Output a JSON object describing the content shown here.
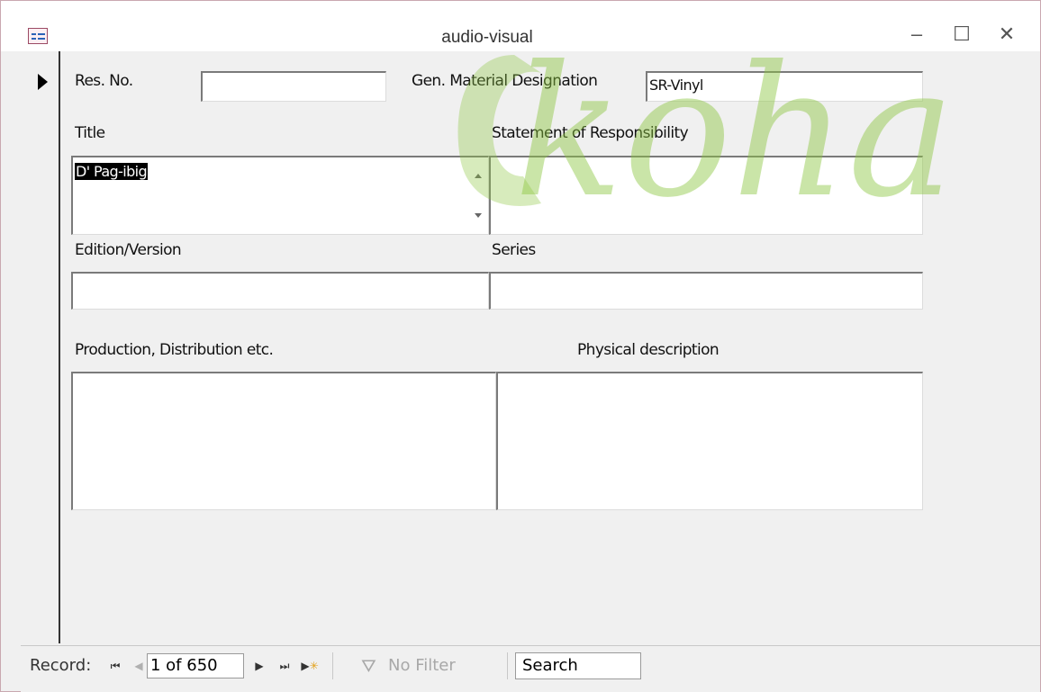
{
  "window": {
    "title": "audio-visual",
    "controls": {
      "minimize": "–",
      "maximize": "☐",
      "close": "✕"
    }
  },
  "watermark": {
    "text": "koha",
    "color": "#8cc63f"
  },
  "form": {
    "res_no": {
      "label": "Res. No.",
      "value": ""
    },
    "gmd": {
      "label": "Gen. Material Designation",
      "value": "SR-Vinyl"
    },
    "title": {
      "label": "Title",
      "value": "D' Pag-ibig"
    },
    "statement": {
      "label": "Statement of Responsibility",
      "value": ""
    },
    "edition": {
      "label": "Edition/Version",
      "value": ""
    },
    "series": {
      "label": "Series",
      "value": ""
    },
    "production": {
      "label": "Production, Distribution etc.",
      "value": ""
    },
    "physical": {
      "label": "Physical description",
      "value": ""
    }
  },
  "navigation": {
    "record_label": "Record:",
    "position": "1 of 650",
    "filter_label": "No Filter",
    "search_placeholder": "Search"
  }
}
